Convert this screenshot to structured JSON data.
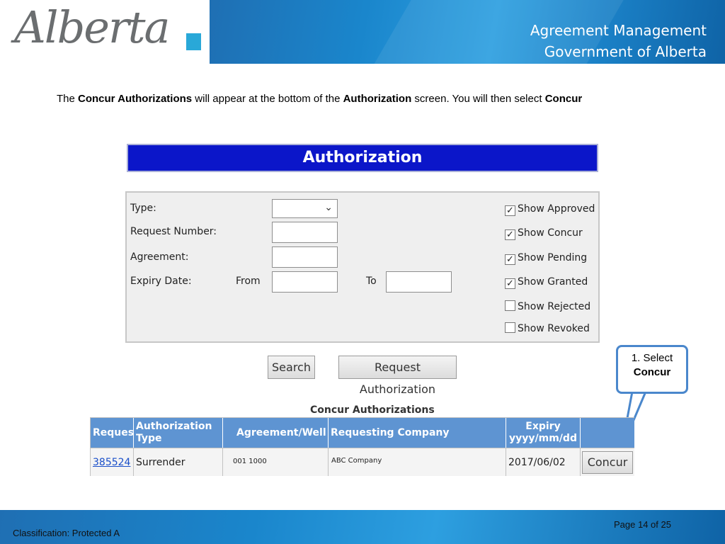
{
  "header": {
    "logo_text": "Alberta",
    "line1": "Agreement Management",
    "line2": "Government of Alberta",
    "logo_accent_color": "#29a8d8",
    "banner_color": "#1a86cc"
  },
  "instruction": {
    "p1": "The ",
    "b1": "Concur Authorizations",
    "p2": " will appear at the bottom of the ",
    "b2": "Authorization",
    "p3": " screen.  You will then select ",
    "b3": "Concur"
  },
  "authorization": {
    "title": "Authorization",
    "title_bar_color": "#0b16c9",
    "form": {
      "type_label": "Type:",
      "type_value": "",
      "request_number_label": "Request Number:",
      "request_number_value": "",
      "agreement_label": "Agreement:",
      "agreement_value": "",
      "expiry_date_label": "Expiry Date:",
      "from_label": "From",
      "from_value": "",
      "to_label": "To",
      "to_value": ""
    },
    "filters": [
      {
        "label": "Show Approved",
        "checked": true
      },
      {
        "label": "Show Concur",
        "checked": true
      },
      {
        "label": "Show Pending",
        "checked": true
      },
      {
        "label": "Show Granted",
        "checked": true
      },
      {
        "label": "Show Rejected",
        "checked": false
      },
      {
        "label": "Show Revoked",
        "checked": false
      }
    ],
    "search_button": "Search",
    "request_authorization_button": "Request Authorization"
  },
  "callout": {
    "line1": "1. Select",
    "line2": "Concur",
    "border_color": "#4a87cc"
  },
  "concur": {
    "title": "Concur Authorizations",
    "header_color": "#5e94d2",
    "columns": {
      "request": "Request",
      "auth_type_1": "Authorization",
      "auth_type_2": "Type",
      "agreement": "Agreement/Well",
      "company": "Requesting Company",
      "expiry_1": "Expiry",
      "expiry_2": "yyyy/mm/dd"
    },
    "row": {
      "request": "385524",
      "auth_type": "Surrender",
      "agreement": "001 1000",
      "company": "ABC Company",
      "expiry": "2017/06/02",
      "action": "Concur"
    }
  },
  "footer": {
    "page": "Page 14 of 25",
    "classification": "Classification: Protected A"
  }
}
